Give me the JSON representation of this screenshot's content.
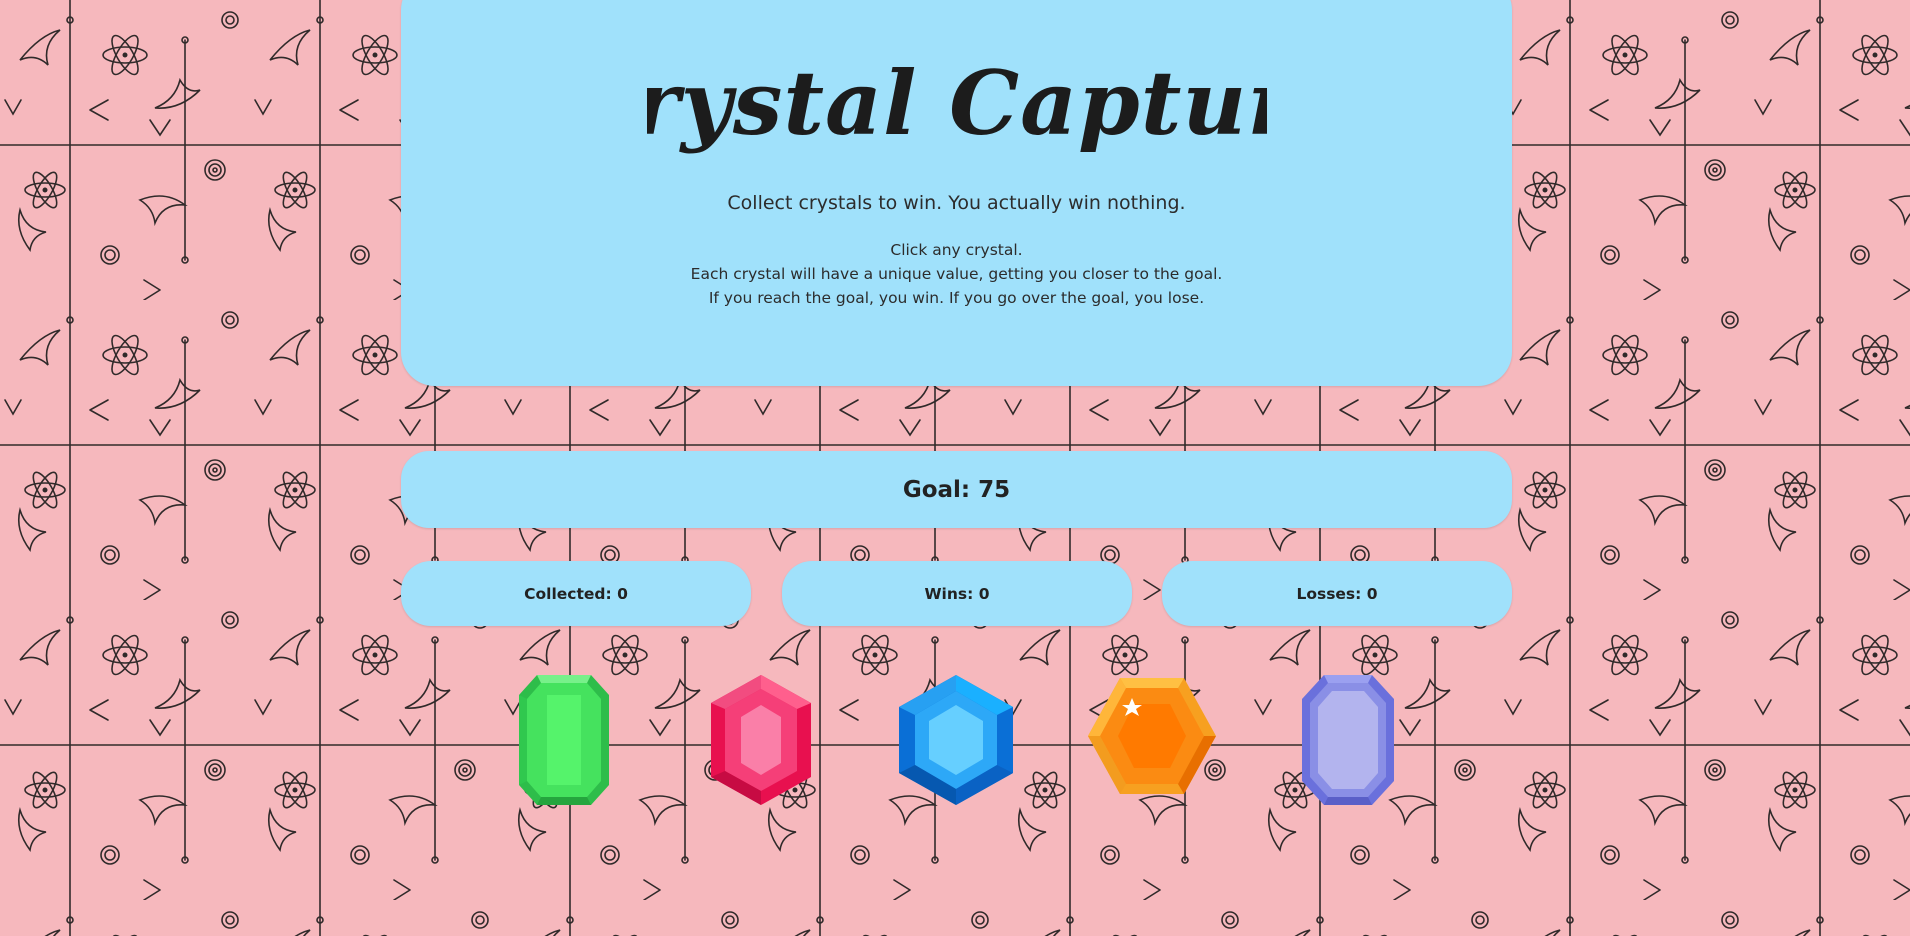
{
  "header": {
    "title": "Crystal Capture",
    "tagline": "Collect crystals to win. You actually win nothing.",
    "instructions": [
      "Click any crystal.",
      "Each crystal will have a unique value, getting you closer to the goal.",
      "If you reach the goal, you win. If you go over the goal, you lose."
    ]
  },
  "goal": {
    "label": "Goal: 75"
  },
  "stats": {
    "collected": {
      "label": "Collected",
      "value": "0"
    },
    "wins": {
      "label": "Wins",
      "value": "0"
    },
    "losses": {
      "label": "Losses",
      "value": "0"
    }
  },
  "crystals": [
    {
      "name": "green-crystal",
      "color": "#3fe05a"
    },
    {
      "name": "pink-crystal",
      "color": "#f0346e"
    },
    {
      "name": "blue-crystal",
      "color": "#1e9bf0"
    },
    {
      "name": "orange-crystal",
      "color": "#fb8b12"
    },
    {
      "name": "purple-crystal",
      "color": "#8a8fe6"
    }
  ],
  "colors": {
    "background": "#f6b8bd",
    "panel": "#a0e1fb",
    "text": "#1c1c1c"
  }
}
